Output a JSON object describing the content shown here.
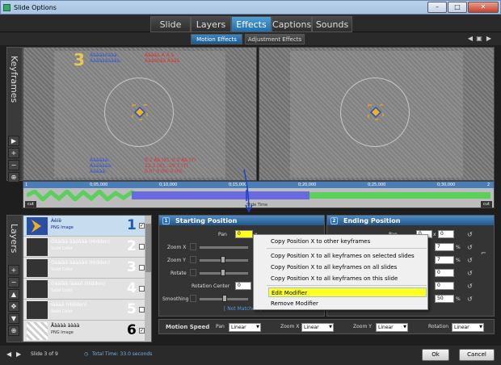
{
  "window": {
    "title": "Slide Options",
    "min_glyph": "–",
    "max_glyph": "□",
    "close_glyph": "✕"
  },
  "tabs": [
    "Slide",
    "Layers",
    "Effects",
    "Captions",
    "Sounds"
  ],
  "active_tab": "Effects",
  "subtabs": [
    "Motion Effects",
    "Adjustment Effects"
  ],
  "keyframes_label": "Keyframes",
  "preview_left": {
    "keyframe_number": "3",
    "blue_top": [
      "Áàáààóààà:",
      "Áààààààààà:"
    ],
    "red_top": [
      "Áàààà Á Á à",
      "Áààóóàà Áààà"
    ],
    "blue_bottom": [
      "Áààààà:",
      "Áàààààà:",
      "Áàààà:"
    ],
    "red_bottom": [
      "0.2 Àà (X), 0.2 Àà (Y)",
      "22.3 (X), -29.7 (Y)",
      "0.0° 0.0% 0.0%"
    ]
  },
  "timeline": {
    "ticks": [
      "0;05,000",
      "0;10,000",
      "0;15,000",
      "0;20,000",
      "0;25,000",
      "0;30,000"
    ],
    "label": "Slide Time",
    "marker_left": "1",
    "marker_right": "2",
    "cut": "cut",
    "cut_right": "cut"
  },
  "layers_label": "Layers",
  "layers": [
    {
      "name": "Àèíè",
      "type": "PNG Image",
      "num": "1",
      "checked": "✓"
    },
    {
      "name": "Óààíàà ààóààà (Hidden)",
      "type": "Solid Color",
      "num": "2",
      "checked": ""
    },
    {
      "name": "Óààíàà àààààó (Hidden)",
      "type": "Solid Color",
      "num": "3",
      "checked": ""
    },
    {
      "name": "Óààíàà íàààó (Hidden)",
      "type": "Solid Color",
      "num": "4",
      "checked": ""
    },
    {
      "name": "Íàààà (Hidden)",
      "type": "Solid Color",
      "num": "5",
      "checked": ""
    },
    {
      "name": "Åàààà àààà",
      "type": "PNG Image",
      "num": "6",
      "checked": "✓"
    }
  ],
  "start_panel": {
    "badge": "1",
    "title": "Starting Position",
    "pan_label": "Pan",
    "pan_x": "0",
    "pan_x_suffix": "x",
    "pan_y": "0",
    "zoomx": "Zoom X",
    "zoomy": "Zoom Y",
    "rotate": "Rotate",
    "rotation_center": "Rotation Center",
    "rot_value": "0",
    "smoothing": "Smoothing",
    "not_matched": "[ Not Matched ]"
  },
  "end_panel": {
    "badge": "2",
    "title": "Ending Position",
    "pan_label": "Pan",
    "pan_x": "0",
    "pan_x_suffix": "x",
    "pan_y": "0",
    "zoomx_val": "7",
    "zoomy_val": "7",
    "rot_val": "0",
    "rc_val": "0",
    "smoothing_val": "50",
    "pct": "%"
  },
  "context_menu": [
    {
      "label": "Copy Position X to other keyframes",
      "highlight": false
    },
    {
      "label": "Copy Position X to all keyframes on selected slides",
      "highlight": false
    },
    {
      "label": "Copy Position X to all keyframes on all slides",
      "highlight": false
    },
    {
      "label": "Copy Position X to all keyframes on this slide",
      "highlight": false
    },
    {
      "label": "Edit Modifier",
      "highlight": true
    },
    {
      "label": "Remove Modifier",
      "highlight": false
    }
  ],
  "motion_speed": {
    "label": "Motion Speed",
    "pan": "Pan",
    "pan_val": "Linear",
    "zoomx": "Zoom X",
    "zoomx_val": "Linear",
    "zoomy": "Zoom Y",
    "zoomy_val": "Linear",
    "rotation": "Rotation",
    "rotation_val": "Linear"
  },
  "status": {
    "slide": "Slide 3 of 9",
    "total": "Total Time: 33.0 seconds",
    "ok": "Ok",
    "cancel": "Cancel"
  },
  "colors": {
    "accent": "#2f86cc",
    "highlight_yellow": "#ffff22",
    "waveform_green": "#5ad05a",
    "waveform_blue": "#6a6ae0"
  }
}
